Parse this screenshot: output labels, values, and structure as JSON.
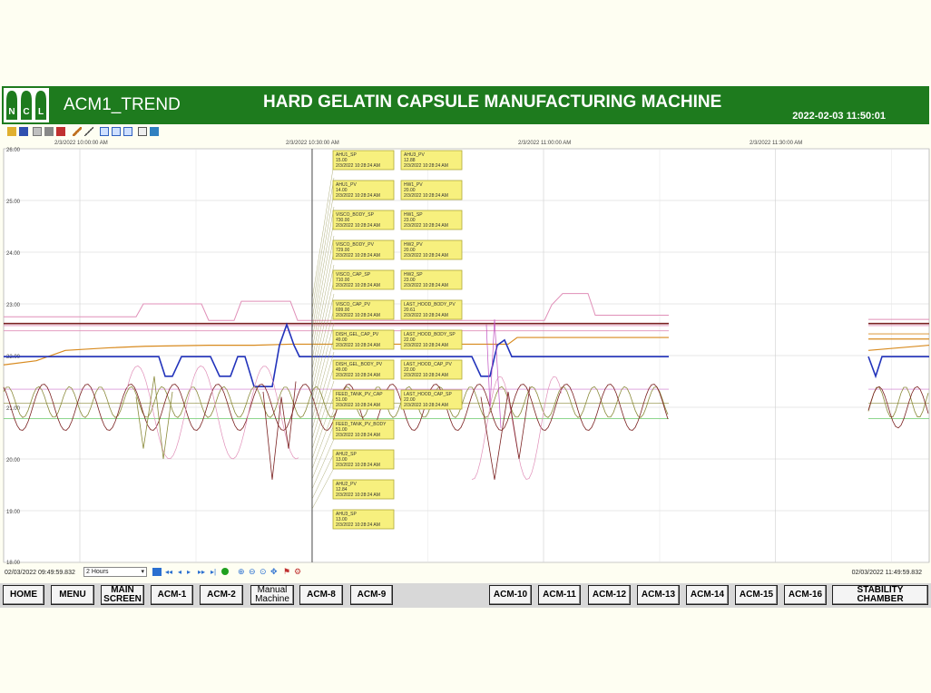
{
  "header": {
    "logo_letters": [
      "N",
      "C",
      "L"
    ],
    "app_title": "ACM1_TREND",
    "machine_title": "HARD GELATIN CAPSULE MANUFACTURING MACHINE",
    "datetime": "2022-02-03 11:50:01"
  },
  "toolbar": {
    "icons": [
      "open-icon",
      "save-icon",
      "copy-icon",
      "print-icon",
      "delete-icon",
      "pen-icon",
      "line-icon",
      "select-icon",
      "pointer-icon",
      "cursor-icon",
      "grid-icon",
      "export-icon"
    ]
  },
  "chart": {
    "time_labels": [
      "2/3/2022 10:00:00 AM",
      "2/3/2022 10:30:00 AM",
      "2/3/2022 11:00:00 AM",
      "2/3/2022 11:30:00 AM"
    ],
    "y_labels": [
      "26.00",
      "25.00",
      "24.00",
      "23.00",
      "22.00",
      "21.00",
      "20.00",
      "19.00",
      "18.00"
    ],
    "colors": {
      "blue": "#2233bb",
      "brown": "#7a2020",
      "pink": "#e08fb8",
      "orange": "#d88a1e",
      "olive": "#8a8a3a",
      "lightgreen": "#7ed07e",
      "magenta": "#c050c0"
    },
    "tooltips_left": [
      {
        "name": "AHU1_SP",
        "value": "15.00",
        "time": "2/3/2022 10:28:24 AM"
      },
      {
        "name": "AHU1_PV",
        "value": "14.00",
        "time": "2/3/2022 10:28:24 AM"
      },
      {
        "name": "VISCO_BODY_SP",
        "value": "730.00",
        "time": "2/3/2022 10:28:24 AM"
      },
      {
        "name": "VISCO_BODY_PV",
        "value": "729.00",
        "time": "2/3/2022 10:28:24 AM"
      },
      {
        "name": "VISCO_CAP_SP",
        "value": "710.00",
        "time": "2/3/2022 10:28:24 AM"
      },
      {
        "name": "VISCO_CAP_PV",
        "value": "699.00",
        "time": "2/3/2022 10:28:24 AM"
      },
      {
        "name": "DISH_GEL_CAP_PV",
        "value": "49.00",
        "time": "2/3/2022 10:28:24 AM"
      },
      {
        "name": "DISH_GEL_BODY_PV",
        "value": "49.00",
        "time": "2/3/2022 10:28:24 AM"
      },
      {
        "name": "FEED_TANK_PV_CAP",
        "value": "51.00",
        "time": "2/3/2022 10:28:24 AM"
      },
      {
        "name": "FEED_TANK_PV_BODY",
        "value": "51.00",
        "time": "2/3/2022 10:28:24 AM"
      },
      {
        "name": "AHU2_SP",
        "value": "13.00",
        "time": "2/3/2022 10:28:24 AM"
      },
      {
        "name": "AHU2_PV",
        "value": "12.84",
        "time": "2/3/2022 10:28:24 AM"
      },
      {
        "name": "AHU3_SP",
        "value": "13.00",
        "time": "2/3/2022 10:28:24 AM"
      }
    ],
    "tooltips_right": [
      {
        "name": "AHU3_PV",
        "value": "12.88",
        "time": "2/3/2022 10:28:24 AM"
      },
      {
        "name": "HW1_PV",
        "value": "20.00",
        "time": "2/3/2022 10:28:24 AM"
      },
      {
        "name": "HW1_SP",
        "value": "23.00",
        "time": "2/3/2022 10:28:24 AM"
      },
      {
        "name": "HW2_PV",
        "value": "20.00",
        "time": "2/3/2022 10:28:24 AM"
      },
      {
        "name": "HW2_SP",
        "value": "23.00",
        "time": "2/3/2022 10:28:24 AM"
      },
      {
        "name": "LAST_HOOD_BODY_PV",
        "value": "20.61",
        "time": "2/3/2022 10:28:24 AM"
      },
      {
        "name": "LAST_HOOD_BODY_SP",
        "value": "22.00",
        "time": "2/3/2022 10:28:24 AM"
      },
      {
        "name": "LAST_HOOD_CAP_PV",
        "value": "22.00",
        "time": "2/3/2022 10:28:24 AM"
      },
      {
        "name": "LAST_HOOD_CAP_SP",
        "value": "22.00",
        "time": "2/3/2022 10:28:24 AM"
      }
    ]
  },
  "statusbar": {
    "start_time": "02/03/2022 09:49:59.832",
    "duration": "2 Hours",
    "end_time": "02/03/2022 11:49:59.832"
  },
  "nav": {
    "home": "HOME",
    "menu": "MENU",
    "main_screen": "MAIN\nSCREEN",
    "acm1": "ACM-1",
    "acm2": "ACM-2",
    "manual": "Manual\nMachine",
    "acm8": "ACM-8",
    "acm9": "ACM-9",
    "acm10": "ACM-10",
    "acm11": "ACM-11",
    "acm12": "ACM-12",
    "acm13": "ACM-13",
    "acm14": "ACM-14",
    "acm15": "ACM-15",
    "acm16": "ACM-16",
    "stability": "STABILITY CHAMBER"
  }
}
